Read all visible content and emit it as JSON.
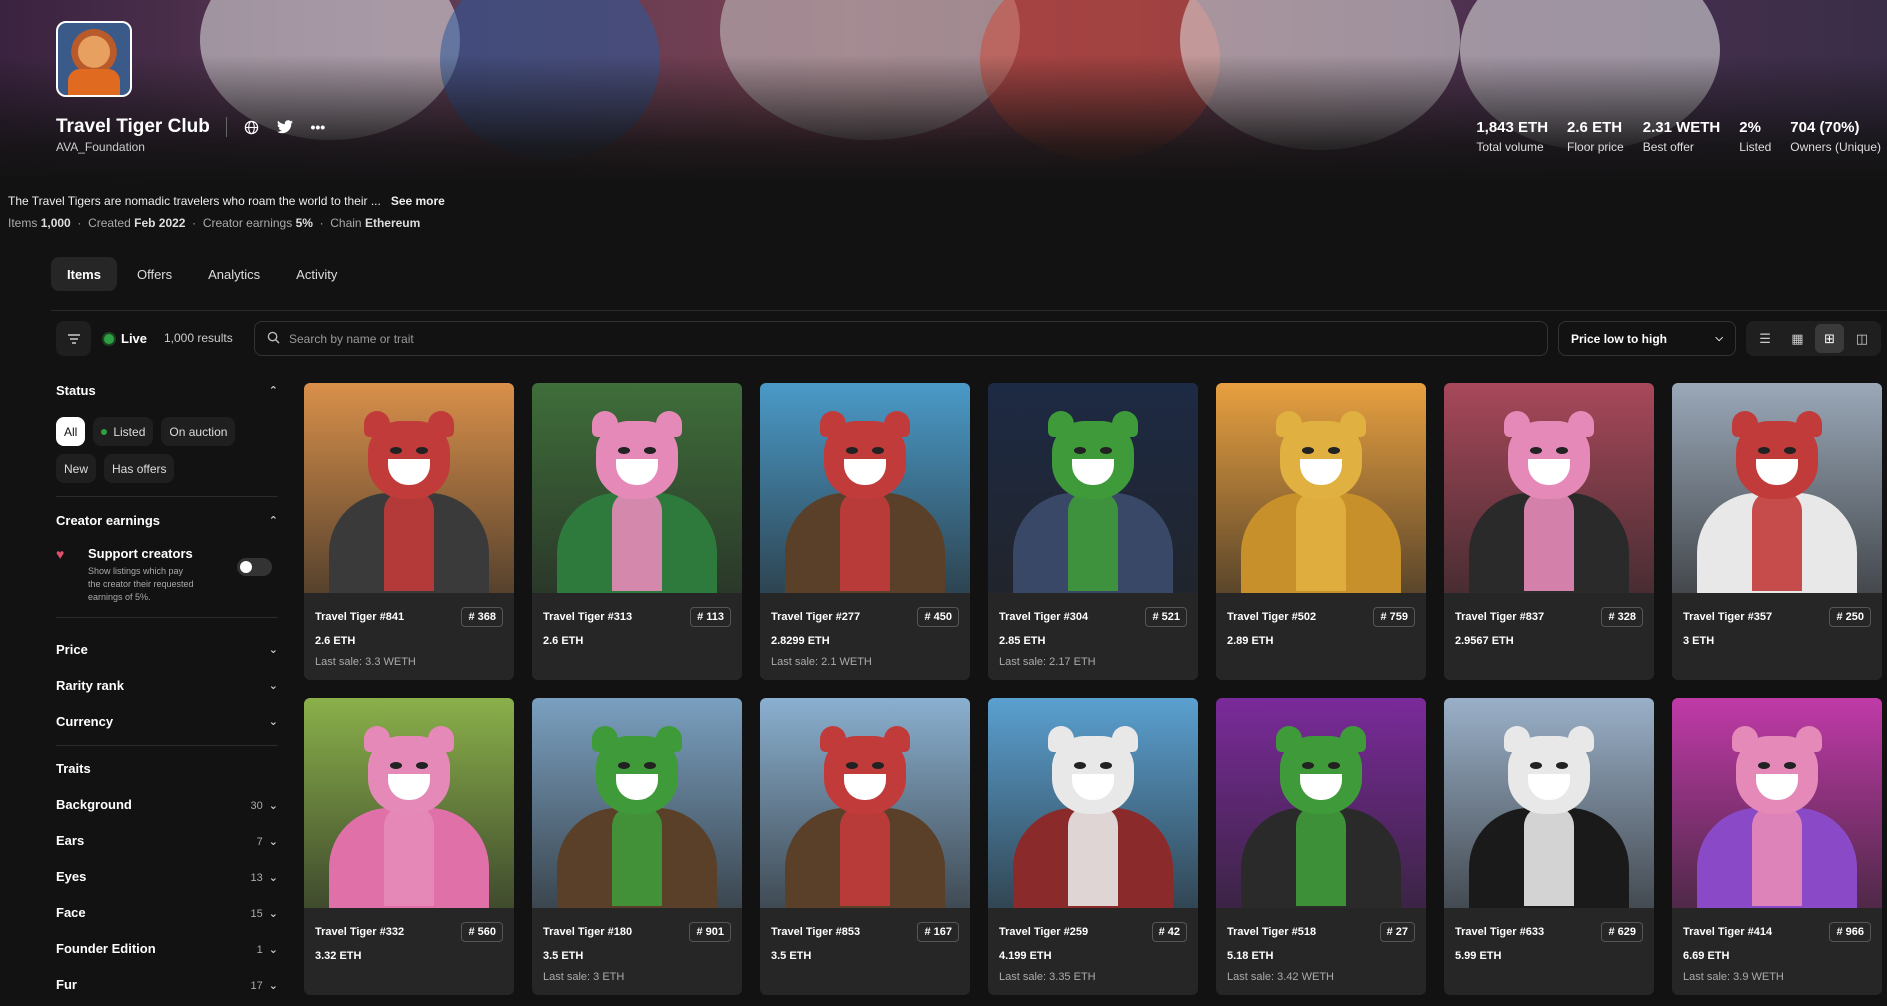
{
  "collection": {
    "name": "Travel Tiger Club",
    "creator": "AVA_Foundation",
    "description": "The Travel Tigers are nomadic travelers who roam the world to their ...",
    "see_more": "See more",
    "meta": {
      "items_label": "Items",
      "items_value": "1,000",
      "created_label": "Created",
      "created_value": "Feb 2022",
      "earnings_label": "Creator earnings",
      "earnings_value": "5%",
      "chain_label": "Chain",
      "chain_value": "Ethereum",
      "dot": "·"
    }
  },
  "header_icons": {
    "globe": "globe-icon",
    "twitter": "twitter-icon",
    "more": "more-icon"
  },
  "stats": [
    {
      "value": "1,843 ETH",
      "label": "Total volume"
    },
    {
      "value": "2.6 ETH",
      "label": "Floor price"
    },
    {
      "value": "2.31 WETH",
      "label": "Best offer"
    },
    {
      "value": "2%",
      "label": "Listed"
    },
    {
      "value": "704 (70%)",
      "label": "Owners (Unique)"
    }
  ],
  "tabs": [
    "Items",
    "Offers",
    "Analytics",
    "Activity"
  ],
  "toolbar": {
    "live": "Live",
    "results": "1,000 results",
    "search_placeholder": "Search by name or trait",
    "sort": "Price low to high"
  },
  "sidebar": {
    "status_title": "Status",
    "status_pills": [
      "All",
      "Listed",
      "On auction",
      "New",
      "Has offers"
    ],
    "earnings_title": "Creator earnings",
    "support_title": "Support creators",
    "support_desc": "Show listings which pay the creator their requested earnings of 5%.",
    "filters": [
      "Price",
      "Rarity rank",
      "Currency"
    ],
    "traits_title": "Traits",
    "traits": [
      {
        "name": "Background",
        "count": "30"
      },
      {
        "name": "Ears",
        "count": "7"
      },
      {
        "name": "Eyes",
        "count": "13"
      },
      {
        "name": "Face",
        "count": "15"
      },
      {
        "name": "Founder Edition",
        "count": "1"
      },
      {
        "name": "Fur",
        "count": "17"
      }
    ]
  },
  "items": [
    {
      "name": "Travel Tiger #841",
      "rank": "# 368",
      "price": "2.6 ETH",
      "last": "Last sale: 3.3 WETH",
      "bg": "#d9904a",
      "fur": "#c23b3b",
      "outfit": "#3a3a3a"
    },
    {
      "name": "Travel Tiger #313",
      "rank": "# 113",
      "price": "2.6 ETH",
      "last": "",
      "bg": "#3f6e3a",
      "fur": "#e58ab8",
      "outfit": "#2e7a3c"
    },
    {
      "name": "Travel Tiger #277",
      "rank": "# 450",
      "price": "2.8299 ETH",
      "last": "Last sale: 2.1 WETH",
      "bg": "#4a9ac8",
      "fur": "#c23b3b",
      "outfit": "#5a4028"
    },
    {
      "name": "Travel Tiger #304",
      "rank": "# 521",
      "price": "2.85 ETH",
      "last": "Last sale: 2.17 ETH",
      "bg": "#1d2a44",
      "fur": "#3f9a3a",
      "outfit": "#3a4868"
    },
    {
      "name": "Travel Tiger #502",
      "rank": "# 759",
      "price": "2.89 ETH",
      "last": "",
      "bg": "#e8a040",
      "fur": "#e0b040",
      "outfit": "#c8902a"
    },
    {
      "name": "Travel Tiger #837",
      "rank": "# 328",
      "price": "2.9567 ETH",
      "last": "",
      "bg": "#a8485a",
      "fur": "#e58ab8",
      "outfit": "#2a2a2a"
    },
    {
      "name": "Travel Tiger #357",
      "rank": "# 250",
      "price": "3 ETH",
      "last": "",
      "bg": "#9aa8b8",
      "fur": "#c23b3b",
      "outfit": "#e8e8e8"
    },
    {
      "name": "Travel Tiger #332",
      "rank": "# 560",
      "price": "3.32 ETH",
      "last": "",
      "bg": "#8ab04a",
      "fur": "#e58ab8",
      "outfit": "#e070a8"
    },
    {
      "name": "Travel Tiger #180",
      "rank": "# 901",
      "price": "3.5 ETH",
      "last": "Last sale: 3 ETH",
      "bg": "#7aa0c0",
      "fur": "#3f9a3a",
      "outfit": "#5a4028"
    },
    {
      "name": "Travel Tiger #853",
      "rank": "# 167",
      "price": "3.5 ETH",
      "last": "",
      "bg": "#8ab0d0",
      "fur": "#c23b3b",
      "outfit": "#5a4028"
    },
    {
      "name": "Travel Tiger #259",
      "rank": "# 42",
      "price": "4.199 ETH",
      "last": "Last sale: 3.35 ETH",
      "bg": "#5aa0d0",
      "fur": "#e8e8e8",
      "outfit": "#8a2a2a"
    },
    {
      "name": "Travel Tiger #518",
      "rank": "# 27",
      "price": "5.18 ETH",
      "last": "Last sale: 3.42 WETH",
      "bg": "#7a2a9a",
      "fur": "#3f9a3a",
      "outfit": "#2a2a2a"
    },
    {
      "name": "Travel Tiger #633",
      "rank": "# 629",
      "price": "5.99 ETH",
      "last": "",
      "bg": "#9ab0c8",
      "fur": "#e8e8e8",
      "outfit": "#1a1a1a"
    },
    {
      "name": "Travel Tiger #414",
      "rank": "# 966",
      "price": "6.69 ETH",
      "last": "Last sale: 3.9 WETH",
      "bg": "#c03aa8",
      "fur": "#e58ab8",
      "outfit": "#8a4ac8"
    }
  ]
}
